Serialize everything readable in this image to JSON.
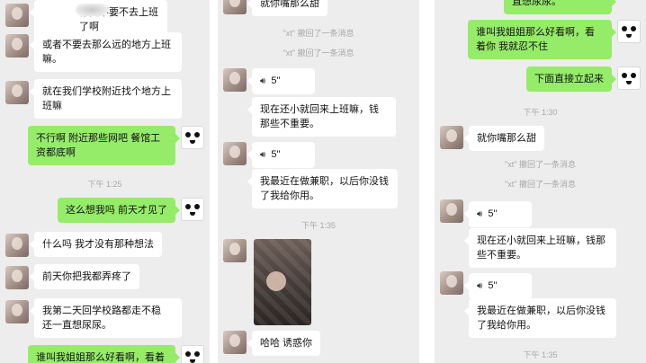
{
  "panel1": {
    "messages": [
      {
        "id": "m1",
        "text": "你要不要不去上班了啊"
      },
      {
        "id": "m2",
        "text": "或者不要去那么远的地方上班嘛。"
      },
      {
        "id": "m3",
        "text": "就在我们学校附近找个地方上班嘛"
      },
      {
        "id": "m4",
        "text": "不行啊 附近那些网吧 餐馆工资都底啊"
      },
      {
        "id": "t1",
        "text": "下午 1:25"
      },
      {
        "id": "m5",
        "text": "这么想我吗 前天才见了"
      },
      {
        "id": "m6",
        "text": "什么吗 我才没有那种想法"
      },
      {
        "id": "m7",
        "text": "前天你把我都弄疼了"
      },
      {
        "id": "m8",
        "text": "我第二天回学校路都走不稳 还一直想尿尿。"
      },
      {
        "id": "m9",
        "text": "谁叫我姐姐那么好看啊，看着"
      }
    ]
  },
  "panel2": {
    "messages": [
      {
        "id": "m1",
        "text": "就你嘴那么甜"
      },
      {
        "id": "s1",
        "text": "\"xt\" 撤回了一条消息"
      },
      {
        "id": "s2",
        "text": "\"xt\" 撤回了一条消息"
      },
      {
        "id": "v1",
        "text": "5''"
      },
      {
        "id": "m2",
        "text": "现在还小就回来上班嘛，钱那些不重要。"
      },
      {
        "id": "v2",
        "text": "5''"
      },
      {
        "id": "m3",
        "text": "我最近在做兼职，以后你没钱了我给你用。"
      },
      {
        "id": "t1",
        "text": "下午 1:35"
      },
      {
        "id": "m4",
        "text": "哈哈 诱惑你"
      }
    ]
  },
  "panel3": {
    "messages": [
      {
        "id": "m0",
        "text": "直想尿尿。"
      },
      {
        "id": "m1",
        "text": "谁叫我姐姐那么好看啊，看着你 我就忍不住"
      },
      {
        "id": "m2",
        "text": "下面直接立起来"
      },
      {
        "id": "t1",
        "text": "下午 1:30"
      },
      {
        "id": "m3",
        "text": "就你嘴那么甜"
      },
      {
        "id": "s1",
        "text": "\"xt\" 撤回了一条消息"
      },
      {
        "id": "s2",
        "text": "\"xt\" 撤回了一条消息"
      },
      {
        "id": "v1",
        "text": "5''"
      },
      {
        "id": "m4",
        "text": "现在还小就回来上班嘛，钱那些不重要。"
      },
      {
        "id": "v2",
        "text": "5''"
      },
      {
        "id": "m5",
        "text": "我最近在做兼职，以后你没钱了我给你用。"
      },
      {
        "id": "t2",
        "text": "下午 1:35"
      }
    ]
  },
  "colors": {
    "sent_bubble": "#95ec69",
    "received_bubble": "#ffffff",
    "chat_bg": "#ededed",
    "meta_text": "#a8a8a8"
  },
  "icons": {
    "voice": "voice-wave-icon",
    "avatar_received": "girl-avatar",
    "avatar_sent": "panda-avatar"
  }
}
